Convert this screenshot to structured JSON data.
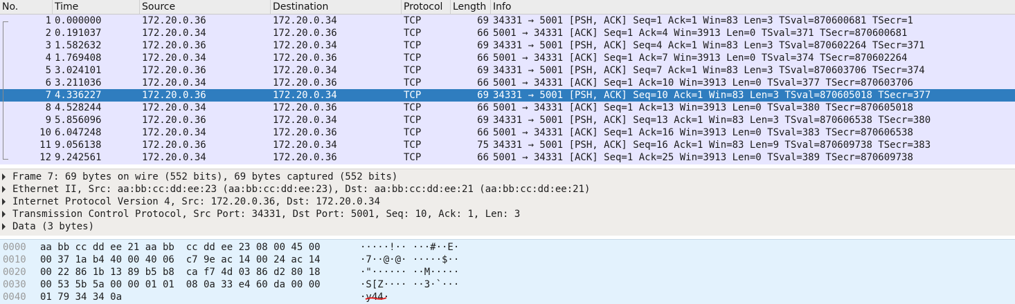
{
  "columns": [
    "No.",
    "Time",
    "Source",
    "Destination",
    "Protocol",
    "Length",
    "Info"
  ],
  "packets": [
    {
      "no": "1",
      "time": "0.000000",
      "src": "172.20.0.36",
      "dst": "172.20.0.34",
      "proto": "TCP",
      "len": "69",
      "info": "34331 → 5001 [PSH, ACK] Seq=1 Ack=1 Win=83 Len=3 TSval=870600681 TSecr=1"
    },
    {
      "no": "2",
      "time": "0.191037",
      "src": "172.20.0.34",
      "dst": "172.20.0.36",
      "proto": "TCP",
      "len": "66",
      "info": "5001 → 34331 [ACK] Seq=1 Ack=4 Win=3913 Len=0 TSval=371 TSecr=870600681"
    },
    {
      "no": "3",
      "time": "1.582632",
      "src": "172.20.0.36",
      "dst": "172.20.0.34",
      "proto": "TCP",
      "len": "69",
      "info": "34331 → 5001 [PSH, ACK] Seq=4 Ack=1 Win=83 Len=3 TSval=870602264 TSecr=371"
    },
    {
      "no": "4",
      "time": "1.769408",
      "src": "172.20.0.34",
      "dst": "172.20.0.36",
      "proto": "TCP",
      "len": "66",
      "info": "5001 → 34331 [ACK] Seq=1 Ack=7 Win=3913 Len=0 TSval=374 TSecr=870602264"
    },
    {
      "no": "5",
      "time": "3.024101",
      "src": "172.20.0.36",
      "dst": "172.20.0.34",
      "proto": "TCP",
      "len": "69",
      "info": "34331 → 5001 [PSH, ACK] Seq=7 Ack=1 Win=83 Len=3 TSval=870603706 TSecr=374"
    },
    {
      "no": "6",
      "time": "3.211036",
      "src": "172.20.0.34",
      "dst": "172.20.0.36",
      "proto": "TCP",
      "len": "66",
      "info": "5001 → 34331 [ACK] Seq=1 Ack=10 Win=3913 Len=0 TSval=377 TSecr=870603706"
    },
    {
      "no": "7",
      "time": "4.336227",
      "src": "172.20.0.36",
      "dst": "172.20.0.34",
      "proto": "TCP",
      "len": "69",
      "info": "34331 → 5001 [PSH, ACK] Seq=10 Ack=1 Win=83 Len=3 TSval=870605018 TSecr=377"
    },
    {
      "no": "8",
      "time": "4.528244",
      "src": "172.20.0.34",
      "dst": "172.20.0.36",
      "proto": "TCP",
      "len": "66",
      "info": "5001 → 34331 [ACK] Seq=1 Ack=13 Win=3913 Len=0 TSval=380 TSecr=870605018"
    },
    {
      "no": "9",
      "time": "5.856096",
      "src": "172.20.0.36",
      "dst": "172.20.0.34",
      "proto": "TCP",
      "len": "69",
      "info": "34331 → 5001 [PSH, ACK] Seq=13 Ack=1 Win=83 Len=3 TSval=870606538 TSecr=380"
    },
    {
      "no": "10",
      "time": "6.047248",
      "src": "172.20.0.34",
      "dst": "172.20.0.36",
      "proto": "TCP",
      "len": "66",
      "info": "5001 → 34331 [ACK] Seq=1 Ack=16 Win=3913 Len=0 TSval=383 TSecr=870606538"
    },
    {
      "no": "11",
      "time": "9.056138",
      "src": "172.20.0.36",
      "dst": "172.20.0.34",
      "proto": "TCP",
      "len": "75",
      "info": "34331 → 5001 [PSH, ACK] Seq=16 Ack=1 Win=83 Len=9 TSval=870609738 TSecr=383"
    },
    {
      "no": "12",
      "time": "9.242561",
      "src": "172.20.0.34",
      "dst": "172.20.0.36",
      "proto": "TCP",
      "len": "66",
      "info": "5001 → 34331 [ACK] Seq=1 Ack=25 Win=3913 Len=0 TSval=389 TSecr=870609738"
    }
  ],
  "selected_packet": "7",
  "details": [
    "Frame 7: 69 bytes on wire (552 bits), 69 bytes captured (552 bits)",
    "Ethernet II, Src: aa:bb:cc:dd:ee:23 (aa:bb:cc:dd:ee:23), Dst: aa:bb:cc:dd:ee:21 (aa:bb:cc:dd:ee:21)",
    "Internet Protocol Version 4, Src: 172.20.0.36, Dst: 172.20.0.34",
    "Transmission Control Protocol, Src Port: 34331, Dst Port: 5001, Seq: 10, Ack: 1, Len: 3",
    "Data (3 bytes)"
  ],
  "bytes": [
    {
      "offset": "0000",
      "hex": "aa bb cc dd ee 21 aa bb  cc dd ee 23 08 00 45 00",
      "ascii": "·····!·· ···#··E·"
    },
    {
      "offset": "0010",
      "hex": "00 37 1a b4 40 00 40 06  c7 9e ac 14 00 24 ac 14",
      "ascii": "·7··@·@· ·····$··"
    },
    {
      "offset": "0020",
      "hex": "00 22 86 1b 13 89 b5 b8  ca f7 4d 03 86 d2 80 18",
      "ascii": "·\"······ ··M·····"
    },
    {
      "offset": "0030",
      "hex": "00 53 5b 5a 00 00 01 01  08 0a 33 e4 60 da 00 00",
      "ascii": "·S[Z···· ··3·`···"
    },
    {
      "offset": "0040",
      "hex": "01 79 34 34 0a",
      "ascii": "·y44·"
    }
  ],
  "colors": {
    "row_bg": "#e7e6ff",
    "selected_bg": "#2f7dbf",
    "details_bg": "#efedea",
    "bytes_bg": "#e3f2fd",
    "annotation": "#e02020"
  }
}
